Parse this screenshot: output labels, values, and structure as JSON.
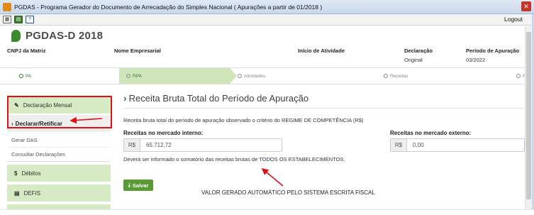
{
  "window": {
    "title": "PGDAS - Programa Gerador do Documento de Arrecadação do Simples Nacional ( Apurações a partir de 01/2018 )",
    "close_glyph": "✕"
  },
  "toolbar": {
    "logout_label": "Logout"
  },
  "app": {
    "title": "PGDAS-D 2018"
  },
  "info": {
    "cnpj_label": "CNPJ da Matriz",
    "name_label": "Nome Empresarial",
    "start_label": "Início de Atividade",
    "decl_label": "Declaração",
    "decl_value": "Original",
    "period_label": "Período de Apuração",
    "period_value": "03/2022"
  },
  "steps": [
    {
      "label": "PA",
      "state": "done"
    },
    {
      "label": "RPA",
      "state": "active"
    },
    {
      "label": "Atividades",
      "state": "pending"
    },
    {
      "label": "Receitas",
      "state": "pending"
    },
    {
      "label": "R",
      "state": "pending"
    }
  ],
  "sidebar": {
    "items": [
      {
        "label": "Declaração Mensal",
        "icon": "pencil-icon"
      },
      {
        "label": "Declarar/Retificar",
        "icon": "chevron-right-icon"
      },
      {
        "label": "Gerar DAS"
      },
      {
        "label": "Consultar Declarações"
      },
      {
        "label": "Débitos",
        "icon": "dollar-icon"
      },
      {
        "label": "DEFIS",
        "icon": "document-icon"
      }
    ]
  },
  "main": {
    "title": "Receita Bruta Total do Período de Apuração",
    "description": "Receita bruta total do período de apuração observado o critério do REGIME DE COMPETÊNCIA (R$)",
    "internal_label": "Receitas no mercado interno:",
    "internal_currency": "R$",
    "internal_value": "65.712,72",
    "external_label": "Receitas no mercado externo:",
    "external_currency": "R$",
    "external_value": "0,00",
    "note": "Deverá ser informado o somatório das receitas brutas de TODOS OS ESTABELECIMENTOS.",
    "save_label": "Salvar",
    "annotation": "VALOR GERADO AUTOMÁTICO PELO SISTEMA ESCRITA FISCAL"
  },
  "colors": {
    "accent_green": "#2f7d2a",
    "annotation_red": "#e01010",
    "title_bar": "#c9d9ec"
  }
}
